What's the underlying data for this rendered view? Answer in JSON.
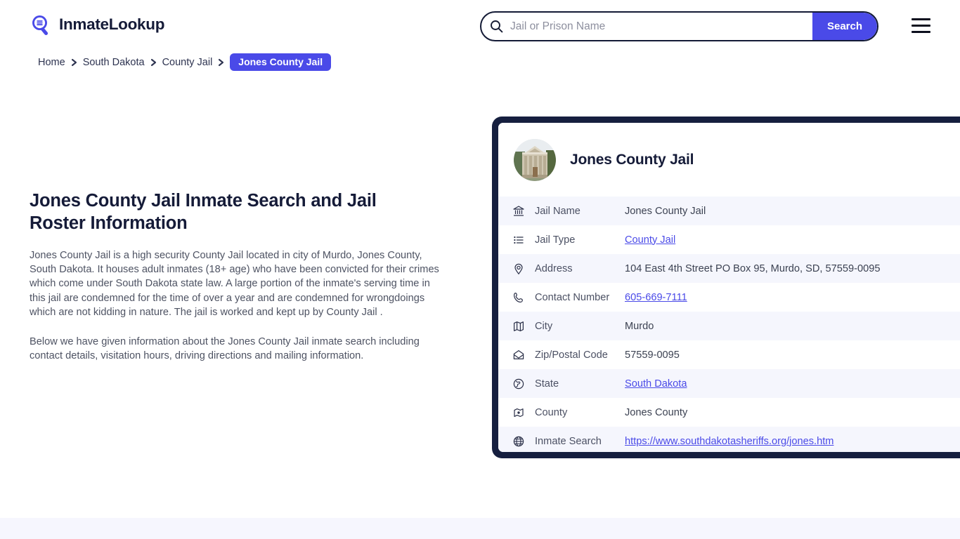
{
  "header": {
    "logo_text": "InmateLookup",
    "logo_icon": "magnifier-list-icon",
    "search": {
      "placeholder": "Jail or Prison Name",
      "value": "",
      "button_label": "Search",
      "icon": "search-icon"
    },
    "menu_icon": "hamburger-menu-icon"
  },
  "breadcrumb": {
    "items": [
      {
        "label": "Home",
        "current": false
      },
      {
        "label": "South Dakota",
        "current": false
      },
      {
        "label": "County Jail",
        "current": false
      },
      {
        "label": "Jones County Jail",
        "current": true
      }
    ],
    "separator_icon": "chevron-right-icon"
  },
  "main": {
    "title": "Jones County Jail Inmate Search and Jail Roster Information",
    "paragraph_1": "Jones County Jail is a high security County Jail located in city of Murdo, Jones County, South Dakota. It houses adult inmates (18+ age) who have been convicted for their crimes which come under South Dakota state law. A large portion of the inmate's serving time in this jail are condemned for the time of over a year and are condemned for wrongdoings which are not kidding in nature. The jail is worked and kept up by County Jail .",
    "paragraph_2": "Below we have given information about the Jones County Jail inmate search including contact details, visitation hours, driving directions and mailing information."
  },
  "card": {
    "title": "Jones County Jail",
    "avatar_icon": "courthouse-photo",
    "rows": [
      {
        "icon": "bank-icon",
        "label": "Jail Name",
        "value": "Jones County Jail",
        "is_link": false
      },
      {
        "icon": "list-icon",
        "label": "Jail Type",
        "value": "County Jail",
        "is_link": true
      },
      {
        "icon": "map-pin-icon",
        "label": "Address",
        "value": "104 East 4th Street PO Box 95, Murdo, SD, 57559-0095",
        "is_link": false
      },
      {
        "icon": "phone-icon",
        "label": "Contact Number",
        "value": "605-669-7111",
        "is_link": true
      },
      {
        "icon": "map-icon",
        "label": "City",
        "value": "Murdo",
        "is_link": false
      },
      {
        "icon": "envelope-icon",
        "label": "Zip/Postal Code",
        "value": "57559-0095",
        "is_link": false
      },
      {
        "icon": "globe-icon",
        "label": "State",
        "value": "South Dakota",
        "is_link": true
      },
      {
        "icon": "county-icon",
        "label": "County",
        "value": "Jones County",
        "is_link": false
      },
      {
        "icon": "world-icon",
        "label": "Inmate Search",
        "value": "https://www.southdakotasheriffs.org/jones.htm",
        "is_link": true
      }
    ]
  },
  "colors": {
    "accent": "#4a4ae8",
    "dark": "#161f3f",
    "row_alt": "#f5f6fd",
    "footer_band": "#f6f6fe",
    "body_text": "#4e5363"
  }
}
